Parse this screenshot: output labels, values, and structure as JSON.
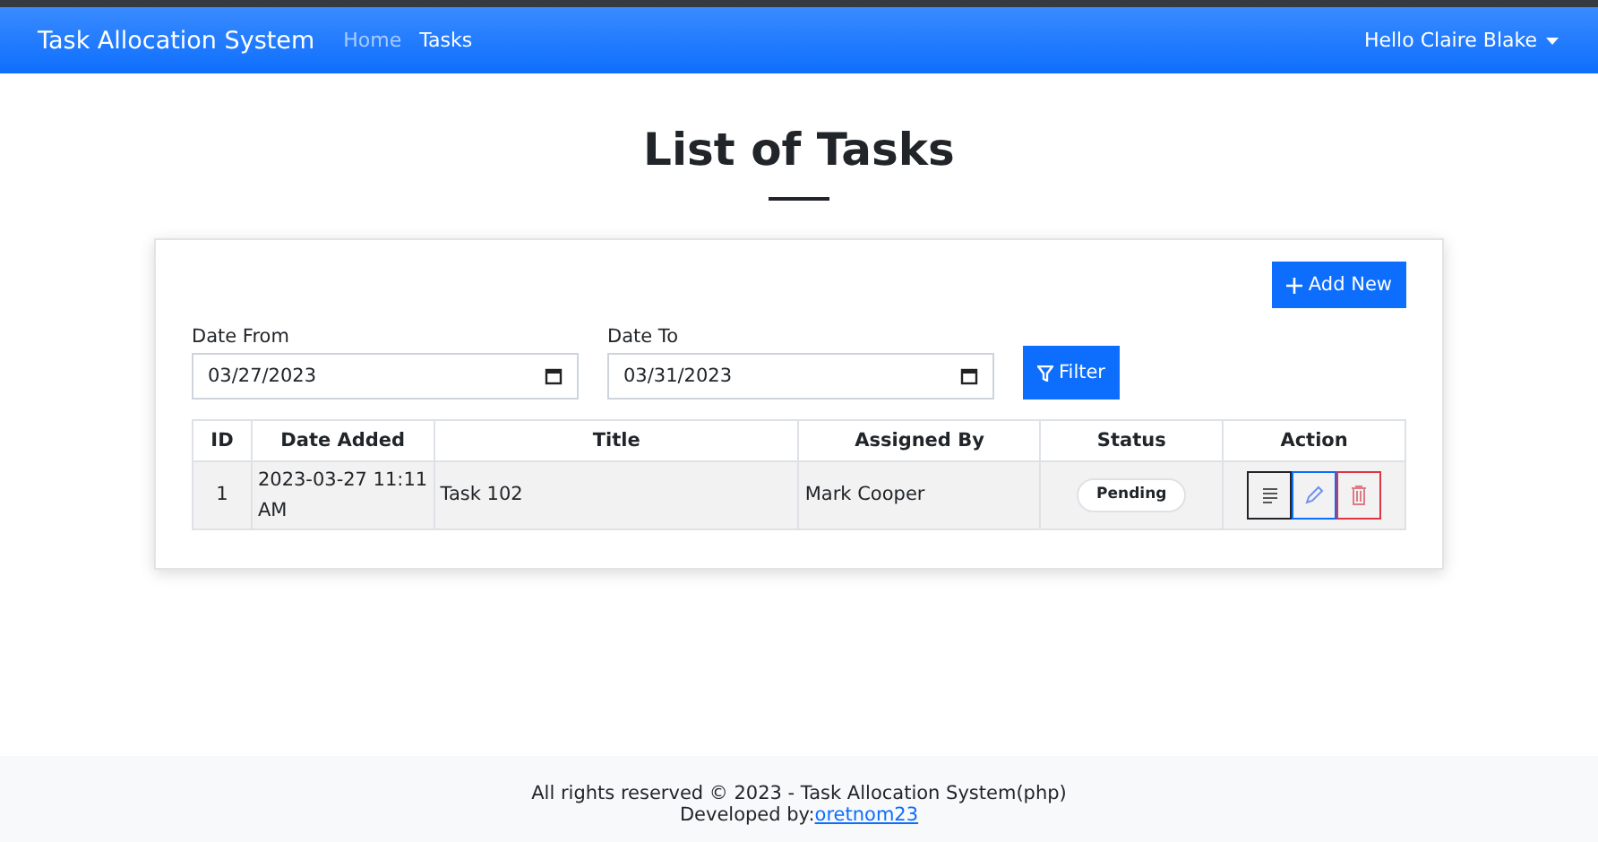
{
  "navbar": {
    "brand": "Task Allocation System",
    "links": [
      {
        "label": "Home",
        "selected": false
      },
      {
        "label": "Tasks",
        "selected": true
      }
    ],
    "user_menu": "Hello Claire Blake"
  },
  "page_title": "List of Tasks",
  "add_button": "Add New",
  "filters": [
    {
      "label": "Date From",
      "value": "03/27/2023"
    },
    {
      "label": "Date To",
      "value": "03/31/2023"
    }
  ],
  "filter_button": "Filter",
  "table": {
    "columns": [
      "ID",
      "Date Added",
      "Title",
      "Assigned By",
      "Status",
      "Action"
    ],
    "rows": [
      {
        "id": "1",
        "date_added": "2023-03-27 11:11 AM",
        "title": "Task 102",
        "assigned_by": "Mark Cooper",
        "status": "Pending",
        "actions": [
          {
            "kind": "view"
          },
          {
            "kind": "edit"
          },
          {
            "kind": "delete"
          }
        ]
      }
    ]
  },
  "footer": {
    "copyright": "All rights reserved © 2023 - Task Allocation System(php)",
    "developed_by": "Developed by:",
    "developer_link": "oretnom23"
  }
}
